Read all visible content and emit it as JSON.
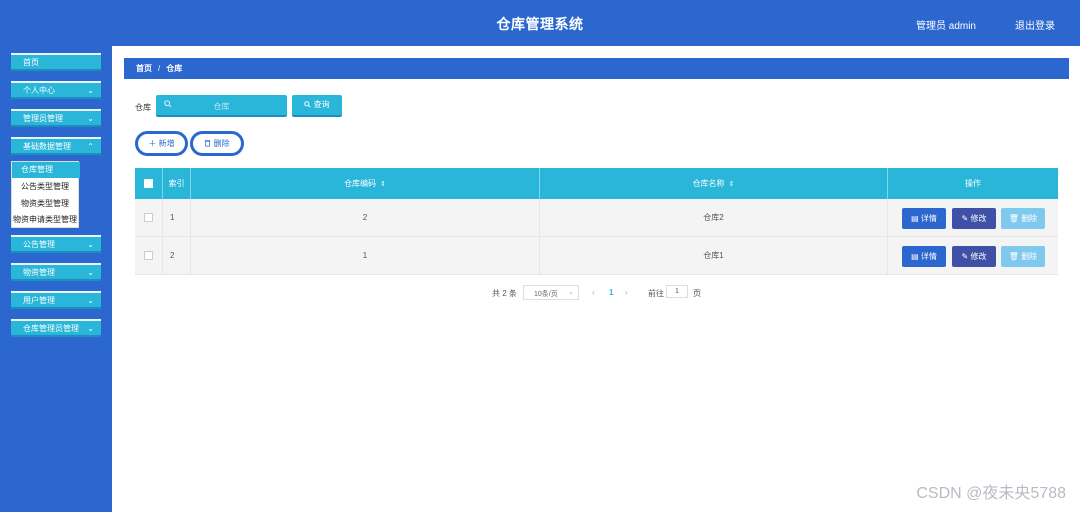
{
  "header": {
    "title": "仓库管理系统",
    "user": "管理员 admin",
    "logout": "退出登录"
  },
  "sidebar": {
    "items": [
      {
        "label": "首页",
        "chevron": ""
      },
      {
        "label": "个人中心",
        "chevron": "⌄"
      },
      {
        "label": "管理员管理",
        "chevron": "⌄"
      },
      {
        "label": "基础数据管理",
        "chevron": "⌃"
      },
      {
        "label": "公告管理",
        "chevron": "⌄"
      },
      {
        "label": "物资管理",
        "chevron": "⌄"
      },
      {
        "label": "用户管理",
        "chevron": "⌄"
      },
      {
        "label": "仓库管理员管理",
        "chevron": "⌄"
      }
    ],
    "submenu": [
      "仓库管理",
      "公告类型管理",
      "物资类型管理",
      "物资申请类型管理"
    ]
  },
  "breadcrumb": {
    "home": "首页",
    "sep": "/",
    "current": "仓库"
  },
  "search": {
    "label": "仓库",
    "placeholder": "仓库",
    "icon": "search-icon",
    "button": "查询"
  },
  "actions": {
    "add": "＋ 新增",
    "delete": "删除"
  },
  "table": {
    "headers": {
      "index": "索引",
      "code": "仓库编码",
      "name": "仓库名称",
      "ops": "操作"
    },
    "rows": [
      {
        "index": "1",
        "code": "2",
        "name": "仓库2"
      },
      {
        "index": "2",
        "code": "1",
        "name": "仓库1"
      }
    ],
    "buttons": {
      "detail": "详情",
      "edit": "修改",
      "remove": "删除"
    }
  },
  "pagination": {
    "total": "共 2 条",
    "page_size": "10条/页",
    "prev": "‹",
    "current_page": "1",
    "next": "›",
    "goto_label": "前往",
    "goto_value": "1",
    "page_unit": "页"
  },
  "watermark": "CSDN @夜未央5788",
  "colors": {
    "primary": "#2b67cf",
    "accent": "#29b6d9",
    "edit": "#3f51a7",
    "remove": "#7fc9ee"
  }
}
